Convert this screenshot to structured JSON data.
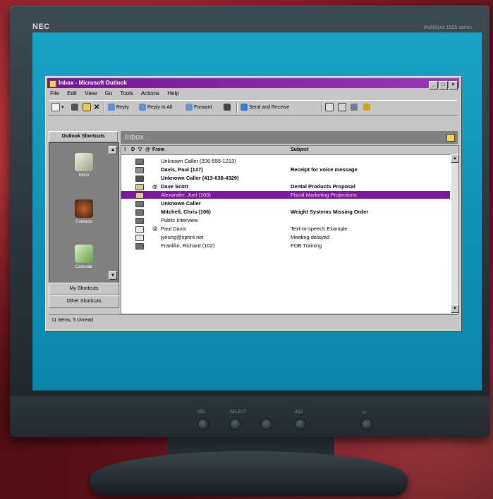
{
  "monitor": {
    "brand": "NEC",
    "model": "MultiSync 1525 series",
    "controls": [
      "SEL",
      "SELECT",
      "ADJ",
      "",
      "⊙"
    ]
  },
  "window": {
    "title": "Inbox - Microsoft Outlook",
    "buttons": [
      "_",
      "□",
      "×"
    ]
  },
  "menu": [
    "File",
    "Edit",
    "View",
    "Go",
    "Tools",
    "Actions",
    "Help"
  ],
  "toolbar": {
    "new": "",
    "reply": "Reply",
    "reply_all": "Reply to All",
    "forward": "Forward",
    "send_receive": "Send and Receive"
  },
  "outlook_bar": {
    "header": "Outlook Shortcuts",
    "items": [
      "Inbox",
      "Contacts",
      "Calendar"
    ],
    "my_shortcuts": "My Shortcuts",
    "other_shortcuts": "Other Shortcuts"
  },
  "inbox": {
    "banner": "Inbox .",
    "columns": {
      "importance": "!",
      "icon": "D",
      "flag": "▽",
      "attach": "@",
      "from": "From",
      "subject": "Subject"
    },
    "messages": [
      {
        "from": "Unknown Caller (206-555-1213)",
        "subject": "",
        "unread": false,
        "selected": false,
        "attach": "",
        "icon": "voice"
      },
      {
        "from": "Davis, Paul (137)",
        "subject": "Receipt for voice message",
        "unread": true,
        "selected": false,
        "attach": "",
        "icon": "receipt"
      },
      {
        "from": "Unknown Caller (413-638-4329)",
        "subject": "",
        "unread": true,
        "selected": false,
        "attach": "",
        "icon": "voice-new"
      },
      {
        "from": "Dave Scott",
        "subject": "Dental Products Proposal",
        "unread": true,
        "selected": false,
        "attach": "@",
        "icon": "mail"
      },
      {
        "from": "Alexander, Joel (100)",
        "subject": "Fiscal Marketing Projections",
        "unread": false,
        "selected": true,
        "attach": "",
        "icon": "mail"
      },
      {
        "from": "Unknown Caller",
        "subject": "",
        "unread": true,
        "selected": false,
        "attach": "",
        "icon": "voice"
      },
      {
        "from": "Mitchell, Chris (106)",
        "subject": "Weight Systems Missing Order",
        "unread": true,
        "selected": false,
        "attach": "",
        "icon": "voice"
      },
      {
        "from": "Public Interview",
        "subject": "",
        "unread": false,
        "selected": false,
        "attach": "",
        "icon": "voice"
      },
      {
        "from": "Paul Davis",
        "subject": "Text-to-speech Example",
        "unread": false,
        "selected": false,
        "attach": "@",
        "icon": "mail-read"
      },
      {
        "from": "jyoung@sprint.net",
        "subject": "Meeting delayed",
        "unread": false,
        "selected": false,
        "attach": "",
        "icon": "mail-read"
      },
      {
        "from": "Franklin, Richard (102)",
        "subject": "FOB Training",
        "unread": false,
        "selected": false,
        "attach": "",
        "icon": "voice"
      }
    ]
  },
  "status": "11 Items, 5 Unread",
  "colors": {
    "titlebar": "#7a1a9a",
    "selected_row": "#7a1a9a",
    "screen": "#1193b8",
    "background": "#8e1f2a"
  }
}
